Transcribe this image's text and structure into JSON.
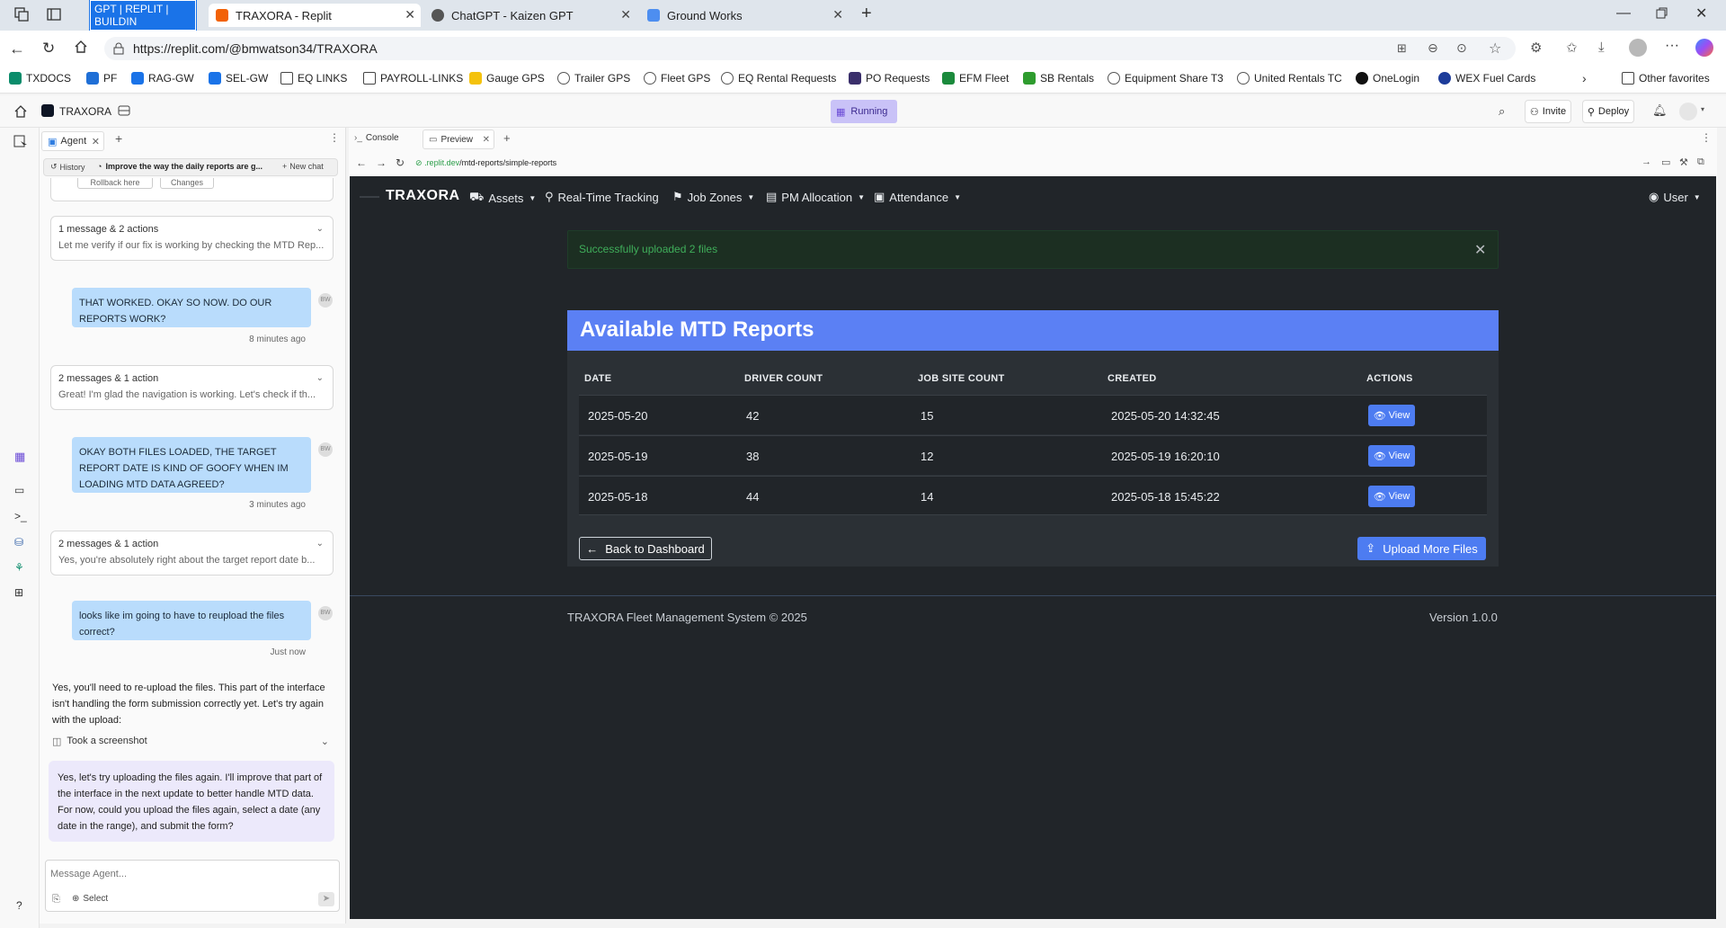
{
  "browser": {
    "tabs": [
      {
        "label": "GPT | REPLIT | BUILDIN",
        "color": "#1a73e8"
      },
      {
        "label": "TRAXORA - Replit",
        "active": true
      },
      {
        "label": "ChatGPT - Kaizen GPT"
      },
      {
        "label": "Ground Works"
      }
    ],
    "url": "https://replit.com/@bmwatson34/TRAXORA",
    "favorites": [
      "TXDOCS",
      "PF",
      "RAG-GW",
      "SEL-GW",
      "EQ LINKS",
      "PAYROLL-LINKS",
      "Gauge GPS",
      "Trailer GPS",
      "Fleet GPS",
      "EQ Rental Requests",
      "PO Requests",
      "EFM Fleet",
      "SB Rentals",
      "Equipment Share T3",
      "United Rentals TC",
      "OneLogin",
      "WEX Fuel Cards"
    ],
    "other_favorites": "Other favorites"
  },
  "workspace": {
    "project_name": "TRAXORA",
    "status": "Running",
    "invite_label": "Invite",
    "deploy_label": "Deploy",
    "agent_tab": "Agent",
    "console_tab": "Console",
    "preview_tab": "Preview",
    "history_label": "History",
    "chat_title": "Improve the way the daily reports are g...",
    "new_chat_label": "New chat",
    "rollback_label": "Rollback here",
    "changes_label": "Changes",
    "preview_url_domain": ".replit.dev",
    "preview_url_path": "/mtd-reports/simple-reports",
    "message_placeholder": "Message Agent...",
    "select_label": "Select",
    "help": "?"
  },
  "chat": {
    "cards": [
      {
        "title": "1 message & 2 actions",
        "preview": "Let me verify if our fix is working by checking the MTD Rep..."
      },
      {
        "title": "2 messages & 1 action",
        "preview": "Great! I'm glad the navigation is working. Let's check if th..."
      },
      {
        "title": "2 messages & 1 action",
        "preview": "Yes, you're absolutely right about the target report date b..."
      }
    ],
    "user_messages": [
      {
        "text": "THAT WORKED. OKAY SO NOW. DO OUR REPORTS WORK?",
        "time": "8 minutes ago",
        "initials": "BW"
      },
      {
        "text": "OKAY BOTH FILES LOADED, THE TARGET REPORT DATE IS KIND OF GOOFY WHEN IM LOADING MTD DATA AGREED?",
        "time": "3 minutes ago",
        "initials": "BW"
      },
      {
        "text": "looks like im going to have to reupload the files correct?",
        "time": "Just now",
        "initials": "BW"
      }
    ],
    "agent_reply": "Yes, you'll need to re-upload the files. This part of the interface isn't handling the form submission correctly yet. Let's try again with the upload:",
    "screenshot_label": "Took a screenshot",
    "agent_followup": "Yes, let's try uploading the files again. I'll improve that part of the interface in the next update to better handle MTD data. For now, could you upload the files again, select a date (any date in the range), and submit the form?"
  },
  "app": {
    "brand": "TRAXORA",
    "nav": [
      "Assets",
      "Real-Time Tracking",
      "Job Zones",
      "PM Allocation",
      "Attendance"
    ],
    "user": "User",
    "alert": "Successfully uploaded 2 files",
    "card_title": "Available MTD Reports",
    "columns": [
      "DATE",
      "DRIVER COUNT",
      "JOB SITE COUNT",
      "CREATED",
      "ACTIONS"
    ],
    "rows": [
      {
        "date": "2025-05-20",
        "drivers": "42",
        "sites": "15",
        "created": "2025-05-20 14:32:45",
        "action": "View"
      },
      {
        "date": "2025-05-19",
        "drivers": "38",
        "sites": "12",
        "created": "2025-05-19 16:20:10",
        "action": "View"
      },
      {
        "date": "2025-05-18",
        "drivers": "44",
        "sites": "14",
        "created": "2025-05-18 15:45:22",
        "action": "View"
      }
    ],
    "back_label": "Back to Dashboard",
    "upload_label": "Upload More Files",
    "footer_left": "TRAXORA Fleet Management System © 2025",
    "footer_right": "Version 1.0.0"
  }
}
